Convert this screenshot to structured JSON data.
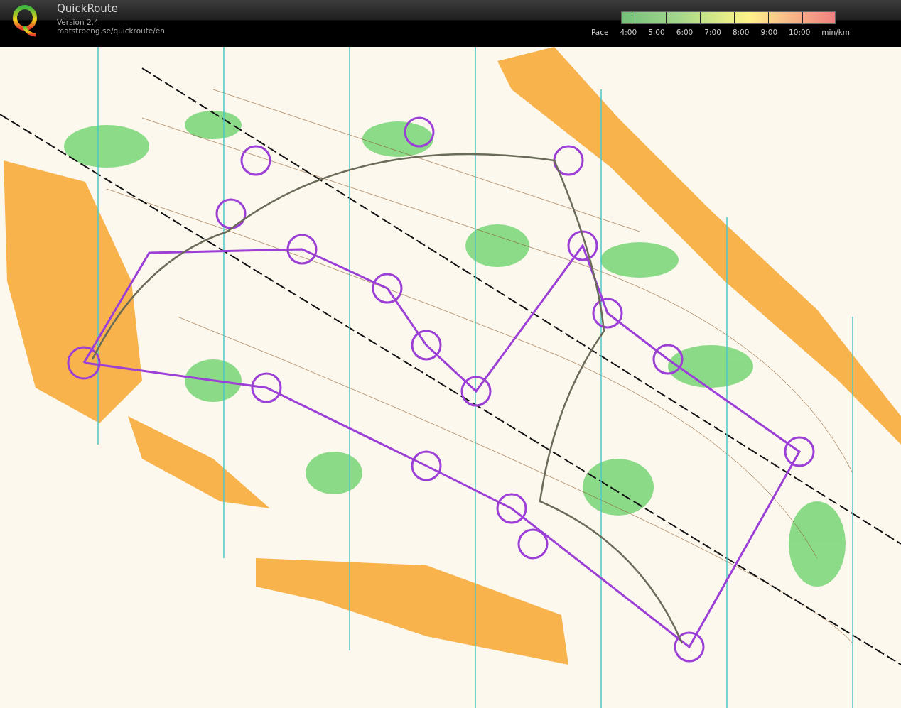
{
  "header": {
    "title": "QuickRoute",
    "version": "Version 2.4",
    "url": "matstroeng.se/quickroute/en"
  },
  "pace_legend": {
    "label": "Pace",
    "ticks": [
      "4:00",
      "5:00",
      "6:00",
      "7:00",
      "8:00",
      "9:00",
      "10:00"
    ],
    "unit": "min/km"
  }
}
